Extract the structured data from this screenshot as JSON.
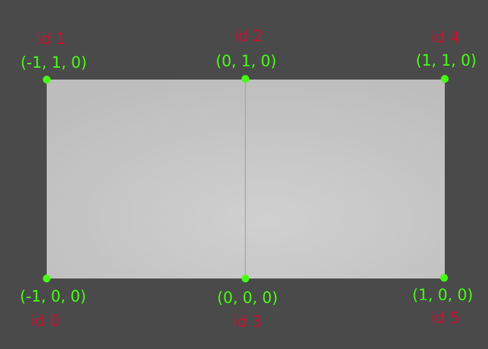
{
  "colors": {
    "background": "#4a4a4a",
    "quad_center": "#d0d0d0",
    "quad_edge": "#bdbdbd",
    "edge_line": "#a8a8a8",
    "vertex_dot": "#44ff11",
    "id_text": "#cc1133",
    "coord_text": "#44ff11"
  },
  "vertices": [
    {
      "id_label": "id 0",
      "coord_label": "(-1, 0, 0)"
    },
    {
      "id_label": "id 1",
      "coord_label": "(-1, 1, 0)"
    },
    {
      "id_label": "id 2",
      "coord_label": "(0, 1, 0)"
    },
    {
      "id_label": "id 3",
      "coord_label": "(0, 0, 0)"
    },
    {
      "id_label": "id 4",
      "coord_label": "(1, 1, 0)"
    },
    {
      "id_label": "id 5",
      "coord_label": "(1, 0, 0)"
    }
  ]
}
